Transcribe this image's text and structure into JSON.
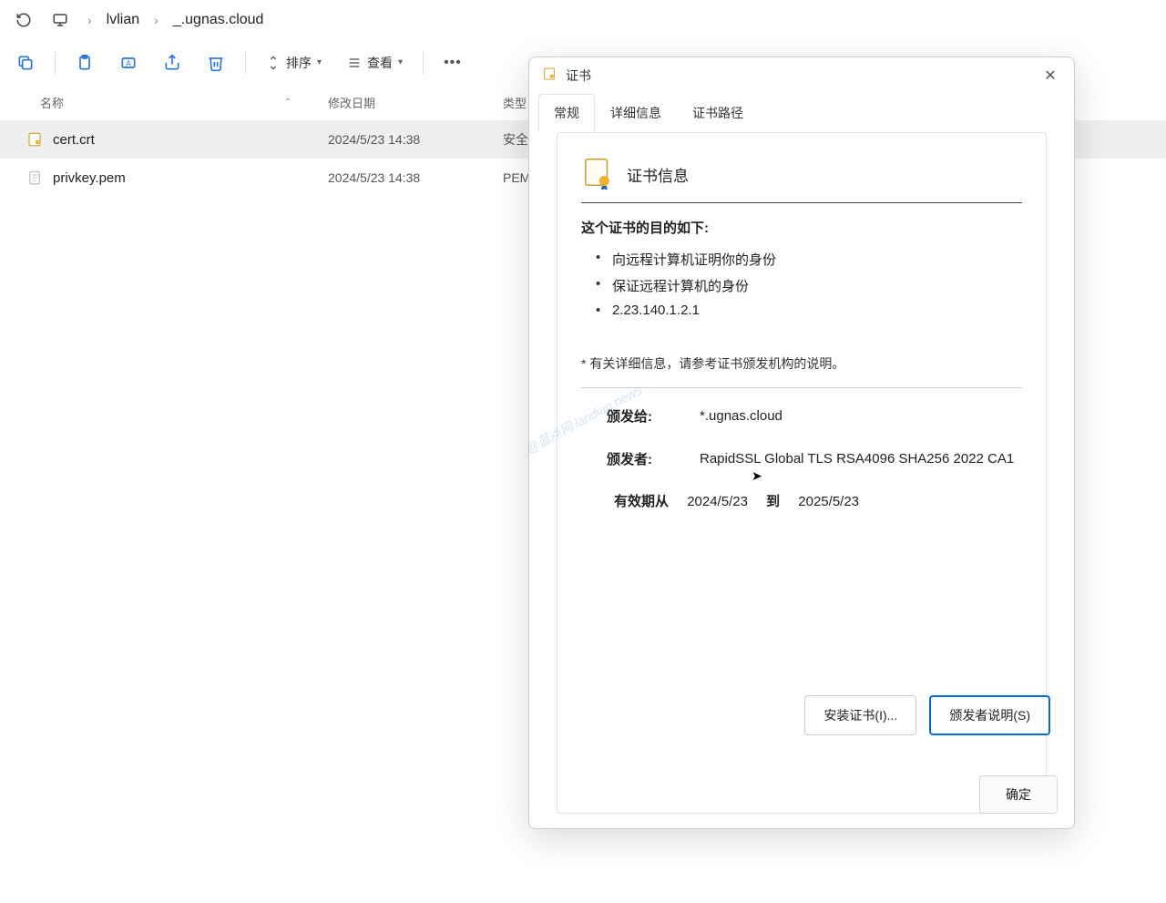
{
  "breadcrumb": {
    "parent": "lvlian",
    "current": "_.ugnas.cloud"
  },
  "toolbar": {
    "sort": "排序",
    "view": "查看"
  },
  "columns": {
    "name": "名称",
    "date": "修改日期",
    "type": "类型"
  },
  "files": [
    {
      "name": "cert.crt",
      "date": "2024/5/23 14:38",
      "type": "安全"
    },
    {
      "name": "privkey.pem",
      "date": "2024/5/23 14:38",
      "type": "PEM"
    }
  ],
  "cert": {
    "window_title": "证书",
    "tabs": {
      "general": "常规",
      "details": "详细信息",
      "path": "证书路径"
    },
    "info_title": "证书信息",
    "purpose_heading": "这个证书的目的如下:",
    "purposes": [
      "向远程计算机证明你的身份",
      "保证远程计算机的身份",
      "2.23.140.1.2.1"
    ],
    "note": "* 有关详细信息，请参考证书颁发机构的说明。",
    "issued_to_label": "颁发给:",
    "issued_to": "*.ugnas.cloud",
    "issued_by_label": "颁发者:",
    "issued_by": "RapidSSL Global TLS RSA4096 SHA256 2022 CA1",
    "validity_label": "有效期从",
    "validity_from": "2024/5/23",
    "validity_to_word": "到",
    "validity_to": "2025/5/23",
    "install_btn": "安装证书(I)...",
    "issuer_btn": "颁发者说明(S)",
    "ok_btn": "确定"
  },
  "watermark": "@蓝点网 landian.news"
}
